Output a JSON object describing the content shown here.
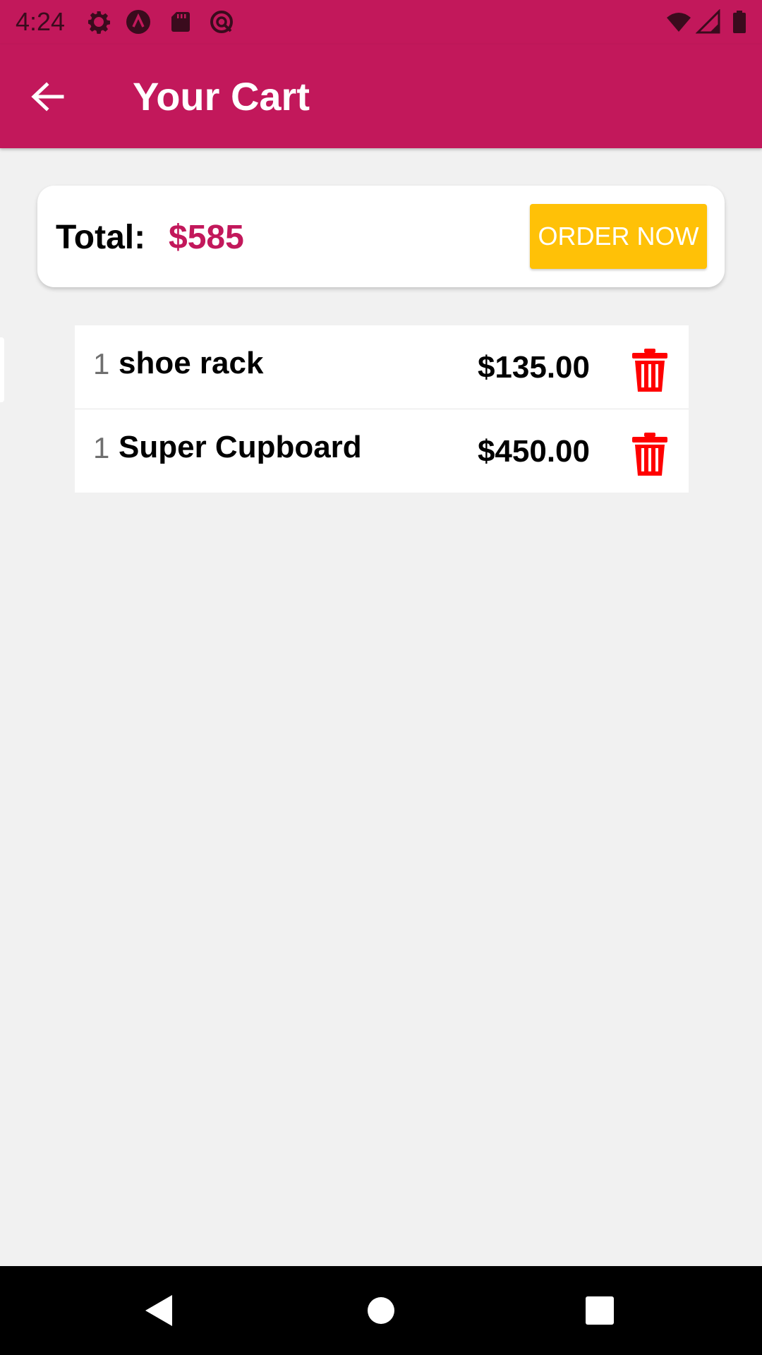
{
  "status_bar": {
    "time": "4:24",
    "left_icons": [
      "gear-icon",
      "app-badge-icon",
      "sd-card-icon",
      "sync-disabled-icon"
    ],
    "right_icons": [
      "wifi-icon",
      "signal-icon",
      "battery-icon"
    ]
  },
  "app_bar": {
    "title": "Your Cart",
    "back_icon": "arrow-back-icon",
    "color": "#c2185b"
  },
  "summary": {
    "total_label": "Total:",
    "total_value": "$585",
    "order_button_label": "ORDER NOW",
    "accent_color": "#c2185b",
    "button_color": "#ffc107"
  },
  "cart": {
    "items": [
      {
        "quantity": "1",
        "name": "shoe rack",
        "price": "$135.00",
        "action_icon": "trash-icon"
      },
      {
        "quantity": "1",
        "name": "Super Cupboard",
        "price": "$450.00",
        "action_icon": "trash-icon"
      }
    ],
    "delete_color": "#ff0000"
  },
  "nav_bar": {
    "buttons": [
      "back-triangle-icon",
      "home-circle-icon",
      "recents-square-icon"
    ]
  }
}
